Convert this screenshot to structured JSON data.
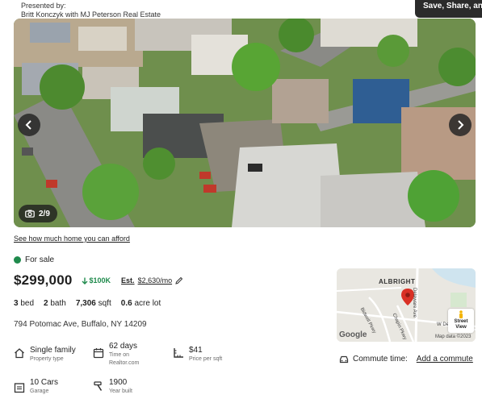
{
  "presented": {
    "line1": "Presented by:",
    "line2": "Britt Konczyk with MJ Peterson Real Estate"
  },
  "share_button": "Save, Share, and",
  "gallery": {
    "counter": "2/9",
    "prev_icon": "chevron-left-icon",
    "next_icon": "chevron-right-icon"
  },
  "afford_link": "See how much home you can afford",
  "listing": {
    "status": "For sale",
    "status_color": "#1f8a4c",
    "price": "$299,000",
    "price_drop": "$100K",
    "est_label": "Est.",
    "est_value": "$2,630/mo",
    "beds_value": "3",
    "beds_label": "bed",
    "baths_value": "2",
    "baths_label": "bath",
    "sqft_value": "7,306",
    "sqft_label": "sqft",
    "lot_value": "0.6",
    "lot_label": "acre lot",
    "address": "794 Potomac Ave, Buffalo, NY 14209"
  },
  "details": {
    "property_type": {
      "value": "Single family",
      "label": "Property type"
    },
    "days": {
      "value": "62 days",
      "label1": "Time on",
      "label2": "Realtor.com"
    },
    "price_sqft": {
      "value": "$41",
      "label": "Price per sqft"
    },
    "garage": {
      "value": "10 Cars",
      "label": "Garage"
    },
    "year_built": {
      "value": "1900",
      "label": "Year built"
    }
  },
  "map": {
    "area": "ALBRIGHT",
    "roads": [
      "Delaware Ave",
      "Bidwell Pkwy",
      "Chapin Pkwy",
      "W De"
    ],
    "google": "Google",
    "copyright": "Map data ©2023",
    "street_view_line1": "Street",
    "street_view_line2": "View"
  },
  "commute": {
    "label": "Commute time:",
    "link": "Add a commute"
  }
}
